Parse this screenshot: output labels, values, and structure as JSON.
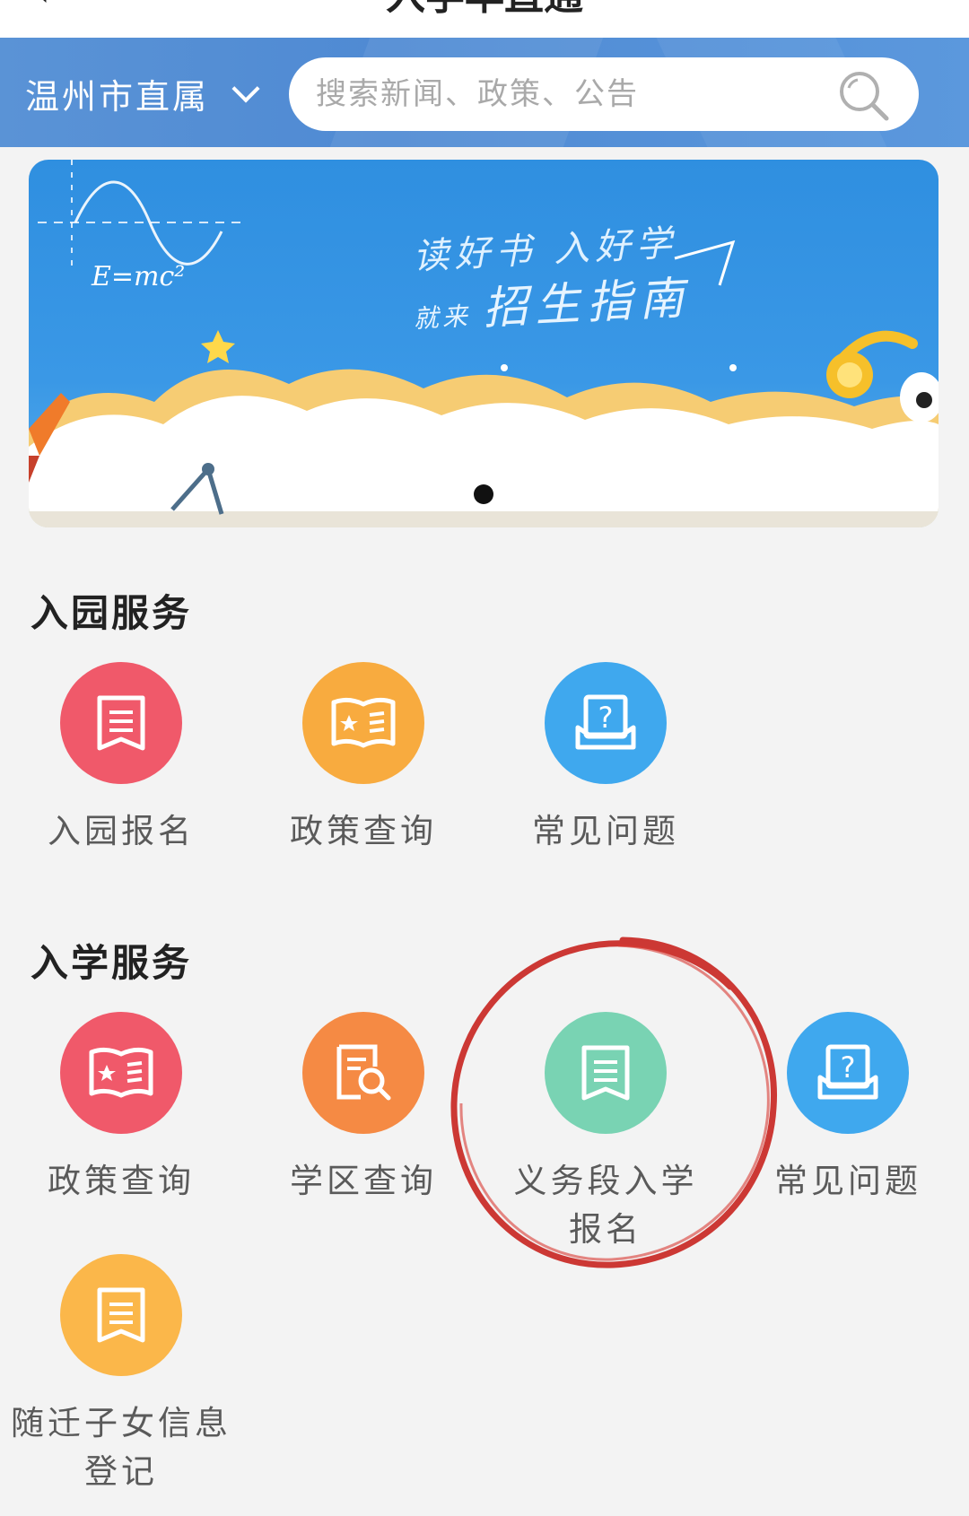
{
  "top_bar": {
    "title": "入学早直通"
  },
  "header": {
    "city": "温州市直属",
    "search_placeholder": "搜索新闻、政策、公告"
  },
  "banner": {
    "line1": "读好书 入好学",
    "line2_prefix": "就来",
    "line2": "招生指南",
    "formula": "E=mc²",
    "page_dots": 1,
    "active_dot": 1
  },
  "kindergarten": {
    "title": "入园服务",
    "items": [
      {
        "label": "入园报名",
        "icon": "document-icon",
        "color": "#f0596a"
      },
      {
        "label": "政策查询",
        "icon": "policy-book-icon",
        "color": "#f8ab3f"
      },
      {
        "label": "常见问题",
        "icon": "question-box-icon",
        "color": "#3fa8ee"
      }
    ]
  },
  "school": {
    "title": "入学服务",
    "items": [
      {
        "label": "政策查询",
        "icon": "policy-book-icon",
        "color": "#f0596a"
      },
      {
        "label": "学区查询",
        "icon": "document-search-icon",
        "color": "#f58a44"
      },
      {
        "label": "义务段入学报名",
        "icon": "document-icon",
        "color": "#79d3b3"
      },
      {
        "label": "常见问题",
        "icon": "question-box-icon",
        "color": "#3fa8ee"
      },
      {
        "label": "随迁子女信息登记",
        "icon": "document-icon",
        "color": "#fbb74a"
      }
    ]
  },
  "annotation": {
    "color": "#c8231f"
  }
}
